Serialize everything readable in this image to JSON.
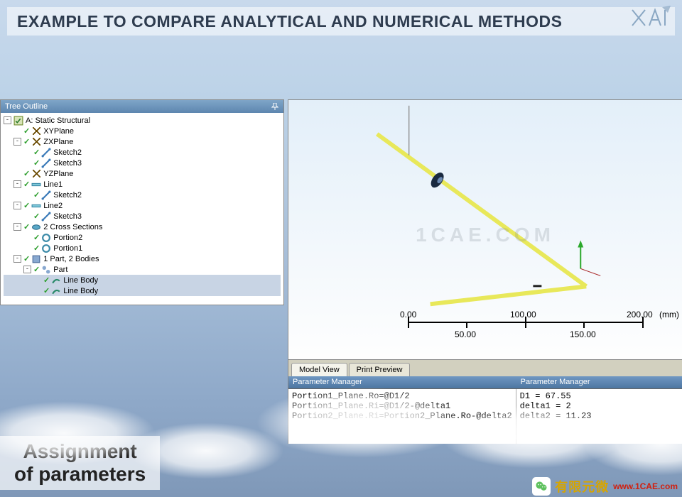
{
  "banner": {
    "title": "EXAMPLE TO COMPARE ANALYTICAL AND NUMERICAL METHODS"
  },
  "caption": {
    "line1": "Assignment",
    "line2": "of parameters"
  },
  "tree": {
    "header": "Tree Outline",
    "root": "A: Static Structural",
    "xyplane": "XYPlane",
    "zxplane": "ZXPlane",
    "sketch2": "Sketch2",
    "sketch3": "Sketch3",
    "yzplane": "YZPlane",
    "line1": "Line1",
    "l1sketch": "Sketch2",
    "line2": "Line2",
    "l2sketch": "Sketch3",
    "cross": "2 Cross Sections",
    "portion2": "Portion2",
    "portion1": "Portion1",
    "part": "1 Part, 2 Bodies",
    "partnode": "Part",
    "body1": "Line Body",
    "body2": "Line Body"
  },
  "viewport": {
    "watermark": "1CAE.COM",
    "scale_unit": "(mm)",
    "ticks_top": [
      "0.00",
      "100.00",
      "200.00"
    ],
    "ticks_bottom": [
      "50.00",
      "150.00"
    ]
  },
  "tabs": {
    "model_view": "Model View",
    "print_preview": "Print Preview"
  },
  "parameter_manager": {
    "header": "Parameter Manager",
    "left_lines": [
      "Portion1_Plane.Ro=@D1/2",
      "Portion1_Plane.Ri=@D1/2-@delta1",
      "Portion2_Plane.Ri=Portion2_Plane.Ro-@delta2"
    ],
    "right_lines": [
      "D1 = 67.55",
      "delta1 = 2",
      "delta2 = 11.23"
    ]
  },
  "footer": {
    "brand_cjk": "有限元微",
    "url": "www.1CAE.com"
  }
}
